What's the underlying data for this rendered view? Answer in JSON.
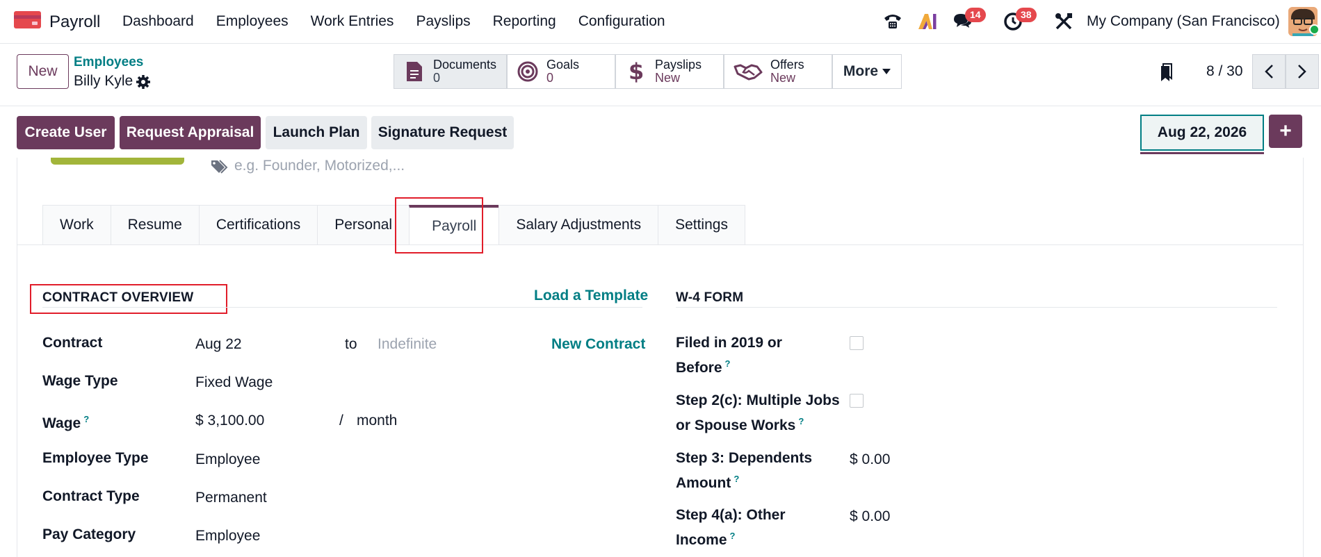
{
  "navbar": {
    "app_name": "Payroll",
    "menu": [
      "Dashboard",
      "Employees",
      "Work Entries",
      "Payslips",
      "Reporting",
      "Configuration"
    ],
    "chat_badge": "14",
    "activity_badge": "38",
    "company": "My Company (San Francisco)"
  },
  "control_panel": {
    "new_label": "New",
    "breadcrumb_parent": "Employees",
    "breadcrumb_current": "Billy Kyle",
    "smart_buttons": [
      {
        "title": "Documents",
        "value": "0",
        "icon": "document-icon"
      },
      {
        "title": "Goals",
        "value": "0",
        "icon": "target-icon"
      },
      {
        "title": "Payslips",
        "value": "New",
        "icon": "dollar-icon"
      },
      {
        "title": "Offers",
        "value": "New",
        "icon": "handshake-icon"
      }
    ],
    "more_label": "More",
    "pager": "8 / 30"
  },
  "header_buttons": {
    "create_user": "Create User",
    "request_appraisal": "Request Appraisal",
    "launch_plan": "Launch Plan",
    "signature_request": "Signature Request",
    "date": "Aug 22, 2026"
  },
  "form": {
    "tags_placeholder": "e.g. Founder, Motorized,...",
    "tabs": [
      "Work",
      "Resume",
      "Certifications",
      "Personal",
      "Payroll",
      "Salary Adjustments",
      "Settings"
    ],
    "active_tab": "Payroll",
    "contract_overview": {
      "title": "CONTRACT OVERVIEW",
      "load_template": "Load a Template",
      "new_contract": "New Contract",
      "contract_label": "Contract",
      "contract_start": "Aug 22",
      "to": "to",
      "contract_end_placeholder": "Indefinite",
      "wage_type_label": "Wage Type",
      "wage_type": "Fixed Wage",
      "wage_label": "Wage",
      "wage": "$ 3,100.00",
      "wage_sep": "/",
      "wage_period": "month",
      "employee_type_label": "Employee Type",
      "employee_type": "Employee",
      "contract_type_label": "Contract Type",
      "contract_type": "Permanent",
      "pay_category_label": "Pay Category",
      "pay_category": "Employee"
    },
    "w4": {
      "title": "W-4 FORM",
      "filed_label_1": "Filed in 2019 or",
      "filed_label_2": "Before",
      "step2c_label_1": "Step 2(c): Multiple Jobs",
      "step2c_label_2": "or Spouse Works",
      "step3_label_1": "Step 3: Dependents",
      "step3_label_2": "Amount",
      "step3_value": "$ 0.00",
      "step4a_label_1": "Step 4(a): Other",
      "step4a_label_2": "Income",
      "step4a_value": "$ 0.00",
      "help_mark": "?"
    }
  },
  "colors": {
    "primary": "#6b3a5c",
    "link": "#017e84",
    "highlight": "#e11d2a",
    "badge": "#e5484d"
  }
}
